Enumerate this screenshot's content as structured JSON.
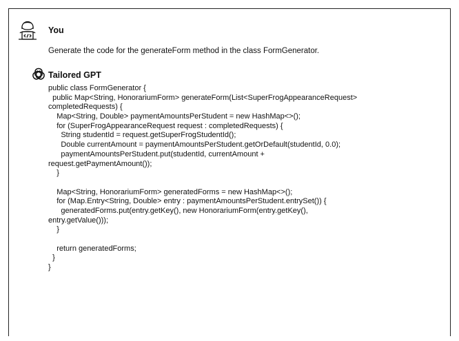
{
  "conversation": {
    "user": {
      "name": "You",
      "icon": "developer-avatar-icon",
      "message": "Generate the code for the generateForm method in the class FormGenerator."
    },
    "assistant": {
      "name": "Tailored GPT",
      "icon": "openai-logo-icon",
      "code_lines": [
        "public class FormGenerator {",
        "  public Map<String, HonorariumForm> generateForm(List<SuperFrogAppearanceRequest>",
        "completedRequests) {",
        "    Map<String, Double> paymentAmountsPerStudent = new HashMap<>();",
        "    for (SuperFrogAppearanceRequest request : completedRequests) {",
        "      String studentId = request.getSuperFrogStudentId();",
        "      Double currentAmount = paymentAmountsPerStudent.getOrDefault(studentId, 0.0);",
        "      paymentAmountsPerStudent.put(studentId, currentAmount +",
        "request.getPaymentAmount());",
        "    }",
        "",
        "    Map<String, HonorariumForm> generatedForms = new HashMap<>();",
        "    for (Map.Entry<String, Double> entry : paymentAmountsPerStudent.entrySet()) {",
        "      generatedForms.put(entry.getKey(), new HonorariumForm(entry.getKey(),",
        "entry.getValue()));",
        "    }",
        "",
        "    return generatedForms;",
        "  }",
        "}"
      ]
    }
  }
}
